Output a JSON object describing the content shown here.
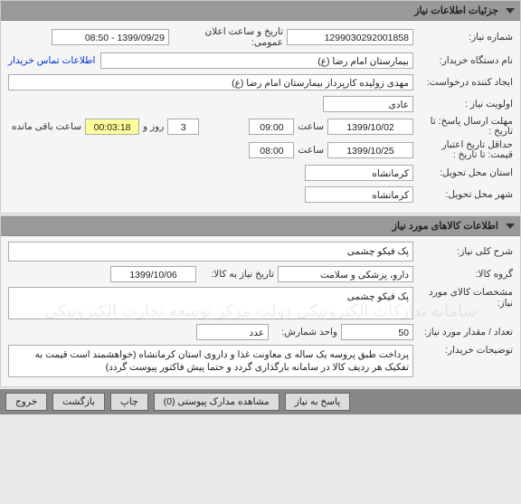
{
  "panel1": {
    "title": "جزئیات اطلاعات نیاز",
    "request_number_label": "شماره نیاز:",
    "request_number": "1299030292001858",
    "public_date_label": "تاریخ و ساعت اعلان عمومی:",
    "public_date": "1399/09/29 - 08:50",
    "buyer_label": "نام دستگاه خریدار:",
    "buyer": "بیمارستان امام رضا (ع)",
    "buyer_contact_link": "اطلاعات تماس خریدار",
    "creator_label": "ایجاد کننده درخواست:",
    "creator": "مهدی زولیده کارپرداز بیمارستان امام رضا (ع)",
    "priority_label": "اولویت نیاز :",
    "priority": "عادی",
    "deadline_label": "مهلت ارسال پاسخ:",
    "to_date_label": "تا تاریخ :",
    "deadline_date": "1399/10/02",
    "time_label": "ساعت",
    "deadline_time": "09:00",
    "days_remaining": "3",
    "days_and_label": "روز و",
    "timer": "00:03:18",
    "remaining_label": "ساعت باقی مانده",
    "min_validity_label": "حداقل تاریخ اعتبار قیمت:",
    "validity_date": "1399/10/25",
    "validity_time": "08:00",
    "delivery_province_label": "استان محل تحویل:",
    "delivery_province": "کرمانشاه",
    "delivery_city_label": "شهر محل تحویل:",
    "delivery_city": "کرمانشاه"
  },
  "panel2": {
    "title": "اطلاعات کالاهای مورد نیاز",
    "desc_label": "شرح کلی نیاز:",
    "desc": "پک فیکو چشمی",
    "group_label": "گروه کالا:",
    "group": "دارو، پزشکی و سلامت",
    "need_by_label": "تاریخ نیاز به کالا:",
    "need_by_date": "1399/10/06",
    "spec_label": "مشخصات کالای مورد نیاز:",
    "spec": "پک فیکو چشمی",
    "qty_label": "تعداد / مقدار مورد نیاز:",
    "qty": "50",
    "unit_label": "واحد شمارش:",
    "unit": "عدد",
    "buyer_notes_label": "توضیحات خریدار:",
    "buyer_notes": "پرداخت طبق پروسه یک ساله ی معاونت غذا و داروی استان کرمانشاه (خواهشمند است قیمت به تفکیک هر ردیف کالا در سامانه بارگذاری گردد و حتما پیش فاکتور پیوست گردد)"
  },
  "buttons": {
    "respond": "پاسخ به نیاز",
    "attachments": "مشاهده مدارک پیوستی (0)",
    "print": "چاپ",
    "back": "بازگشت",
    "exit": "خروج"
  },
  "watermark": "سامانه تدارکات الکترونیکی دولت\nمرکز توسعه تجارت الکترونیکی"
}
